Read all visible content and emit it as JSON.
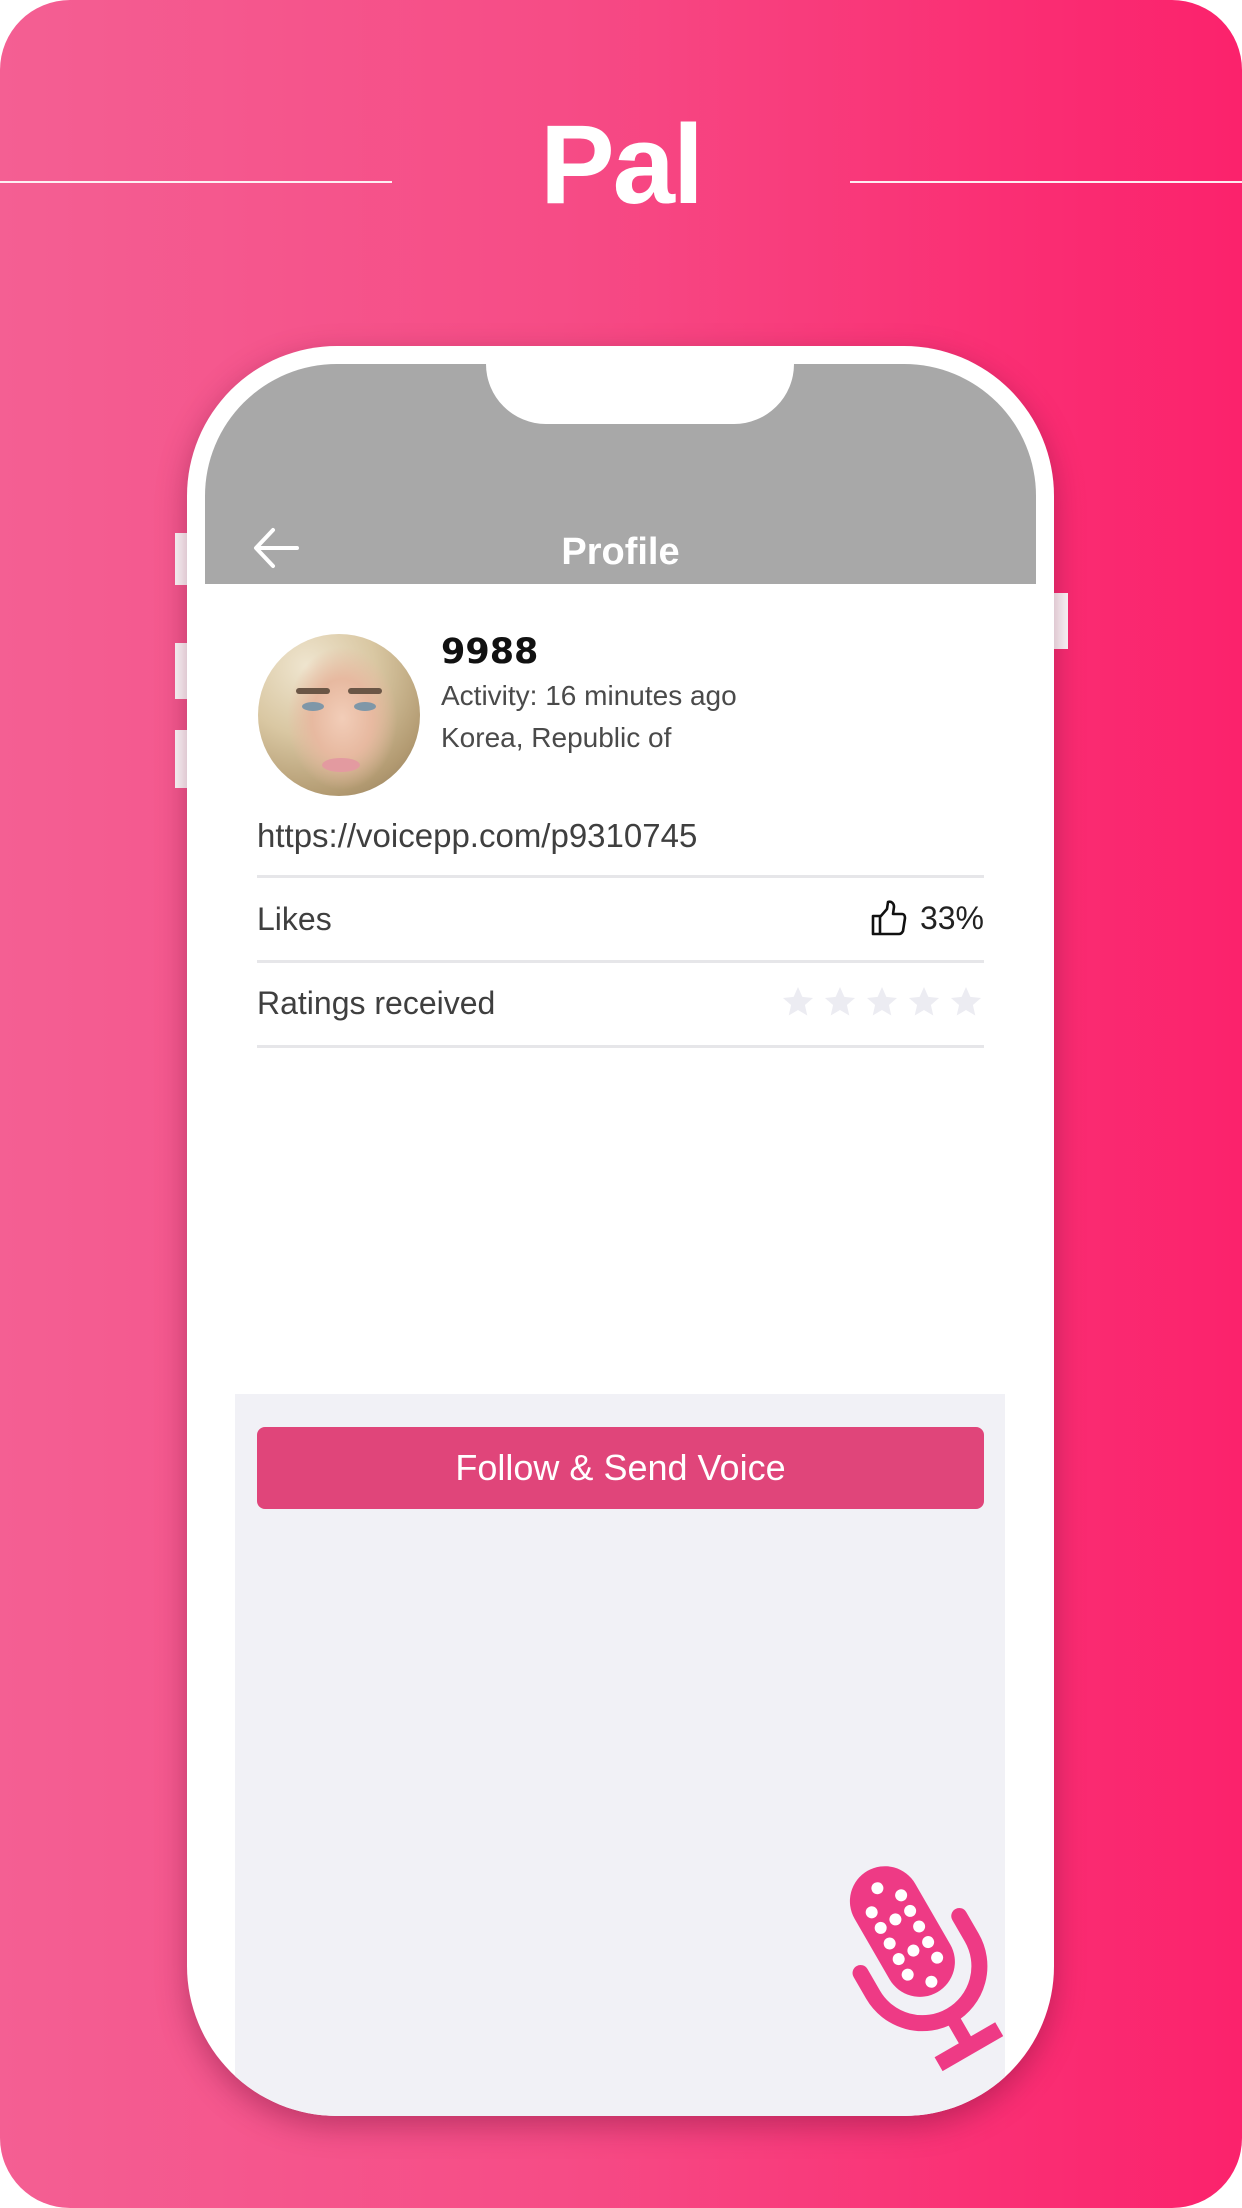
{
  "promo": {
    "app_title": "Pal",
    "brand_color": "#f64c86",
    "accent_color": "#e0457a"
  },
  "header": {
    "title": "Profile",
    "back_icon": "arrow-left-icon"
  },
  "profile": {
    "avatar_icon": "profile-photo",
    "name": "9988",
    "activity": "Activity: 16 minutes ago",
    "location": "Korea, Republic of",
    "url": "https://voicepp.com/p9310745"
  },
  "stats": {
    "likes_label": "Likes",
    "likes_icon": "thumbs-up-icon",
    "likes_value": "33%",
    "ratings_label": "Ratings received",
    "ratings_icon": "star-icon",
    "ratings_filled": 0,
    "ratings_max": 5
  },
  "actions": {
    "follow_label": "Follow & Send Voice"
  },
  "decor": {
    "mic_icon": "microphone-icon"
  }
}
